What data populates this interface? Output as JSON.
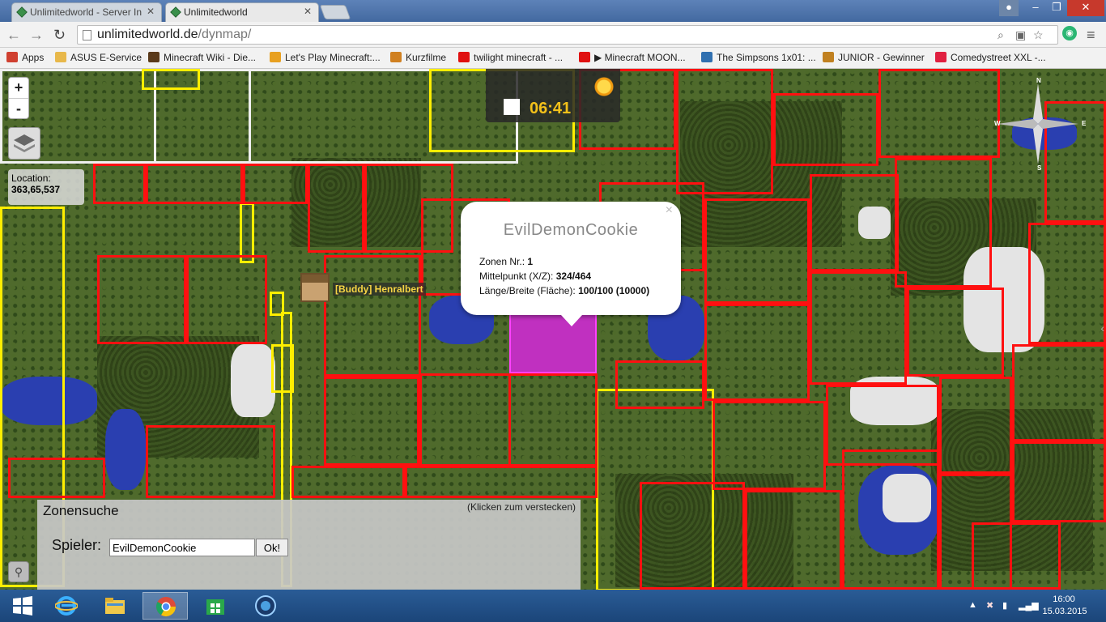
{
  "browser": {
    "tabs": [
      {
        "title": "Unlimitedworld - Server In",
        "active": false
      },
      {
        "title": "Unlimitedworld",
        "active": true
      }
    ],
    "url_host": "unlimitedworld.de",
    "url_path": "/dynmap/",
    "bookmarks": [
      {
        "label": "Apps",
        "icon": "apps-grid-icon",
        "color": "#d04030"
      },
      {
        "label": "ASUS E-Service",
        "icon": "folder-icon",
        "color": "#e8b84a"
      },
      {
        "label": "Minecraft Wiki - Die...",
        "icon": "minecraft-icon",
        "color": "#5a3a1a"
      },
      {
        "label": "Let's Play Minecraft:...",
        "icon": "letsplay-icon",
        "color": "#e8a020"
      },
      {
        "label": "Kurzfilme",
        "icon": "film-icon",
        "color": "#d08020"
      },
      {
        "label": "twilight minecraft - ...",
        "icon": "youtube-icon",
        "color": "#e01010"
      },
      {
        "label": "▶ Minecraft MOON...",
        "icon": "youtube-icon",
        "color": "#e01010"
      },
      {
        "label": "The Simpsons 1x01: ...",
        "icon": "tv-icon",
        "color": "#3070b0"
      },
      {
        "label": "JUNIOR -  Gewinner",
        "icon": "junior-icon",
        "color": "#c08020"
      },
      {
        "label": "Comedystreet XXL -...",
        "icon": "comedy-icon",
        "color": "#e02040"
      }
    ]
  },
  "map": {
    "zoom_in": "+",
    "zoom_out": "-",
    "location_label": "Location:",
    "location_value": "363,65,537",
    "clock_time": "06:41",
    "compass": {
      "n": "N",
      "e": "E",
      "s": "S",
      "w": "W"
    },
    "player_name": "[Buddy] Henralbert"
  },
  "popup": {
    "title": "EvilDemonCookie",
    "close": "×",
    "rows": [
      {
        "label": "Zonen Nr.: ",
        "value": "1"
      },
      {
        "label": "Mittelpunkt (X/Z): ",
        "value": "324/464"
      },
      {
        "label": "Länge/Breite (Fläche): ",
        "value": "100/100 (10000)"
      }
    ]
  },
  "zone_search": {
    "title": "Zonensuche",
    "hide_hint": "(Klicken zum verstecken)",
    "player_label": "Spieler:",
    "player_value": "EvilDemonCookie",
    "ok_label": "Ok!"
  },
  "taskbar": {
    "apps": [
      "windows-start-icon",
      "internet-explorer-icon",
      "file-explorer-icon",
      "chrome-icon",
      "store-icon",
      "app-icon"
    ],
    "time": "16:00",
    "date": "15.03.2015"
  }
}
